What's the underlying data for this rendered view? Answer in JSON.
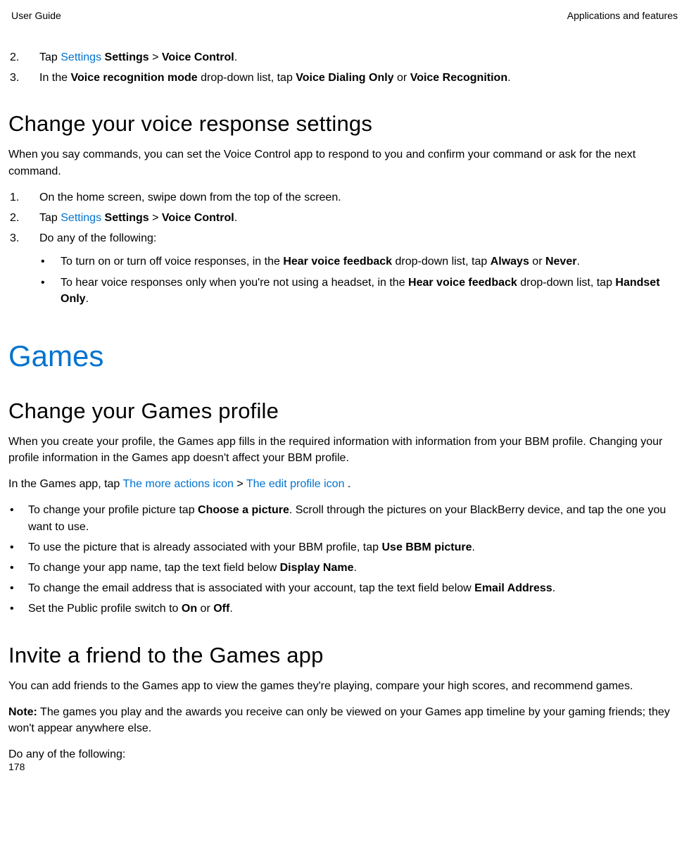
{
  "header": {
    "left": "User Guide",
    "right": "Applications and features"
  },
  "steps_top": {
    "item2": {
      "num": "2.",
      "pre": "Tap ",
      "blue": "Settings",
      "sp": " ",
      "b1": "Settings",
      "gt": " > ",
      "b2": "Voice Control",
      "end": "."
    },
    "item3": {
      "num": "3.",
      "pre": "In the ",
      "b1": "Voice recognition mode",
      "mid": " drop-down list, tap ",
      "b2": "Voice Dialing Only",
      "or": " or ",
      "b3": "Voice Recognition",
      "end": "."
    }
  },
  "h2a": "Change your voice response settings",
  "p1": "When you say commands, you can set the Voice Control app to respond to you and confirm your command or ask for the next command.",
  "steps_voice": {
    "item1": {
      "num": "1.",
      "text": "On the home screen, swipe down from the top of the screen."
    },
    "item2": {
      "num": "2.",
      "pre": "Tap ",
      "blue": "Settings",
      "sp": "  ",
      "b1": "Settings",
      "gt": " > ",
      "b2": "Voice Control",
      "end": "."
    },
    "item3": {
      "num": "3.",
      "text": "Do any of the following:"
    }
  },
  "voice_bullets": {
    "b1": {
      "pre": "To turn on or turn off voice responses, in the ",
      "b1": "Hear voice feedback",
      "mid": " drop-down list, tap ",
      "b2": "Always",
      "or": " or ",
      "b3": "Never",
      "end": "."
    },
    "b2": {
      "pre": "To hear voice responses only when you're not using a headset, in the ",
      "b1": "Hear voice feedback",
      "mid": " drop-down list, tap ",
      "b2": "Handset Only",
      "end": "."
    }
  },
  "h1a": "Games",
  "h2b": "Change your Games profile",
  "p2": "When you create your profile, the Games app fills in the required information with information from your BBM profile. Changing your profile information in the Games app doesn't affect your BBM profile.",
  "p3": {
    "pre": "In the Games app, tap ",
    "blue1": "The more actions icon",
    "gt": "  > ",
    "blue2": "The edit profile icon",
    "end": " ."
  },
  "profile_bullets": {
    "b1": {
      "pre": "To change your profile picture tap ",
      "b1": "Choose a picture",
      "rest": ". Scroll through the pictures on your BlackBerry device, and tap the one you want to use."
    },
    "b2": {
      "pre": "To use the picture that is already associated with your BBM profile, tap ",
      "b1": "Use BBM picture",
      "end": "."
    },
    "b3": {
      "pre": "To change your app name, tap the text field below ",
      "b1": "Display Name",
      "end": "."
    },
    "b4": {
      "pre": "To change the email address that is associated with your account, tap the text field below ",
      "b1": "Email Address",
      "end": "."
    },
    "b5": {
      "pre": "Set the Public profile switch to ",
      "b1": "On",
      "or": " or ",
      "b2": "Off",
      "end": "."
    }
  },
  "h2c": "Invite a friend to the Games app",
  "p4": "You can add friends to the Games app to view the games they're playing, compare your high scores, and recommend games.",
  "p5": {
    "b": "Note:",
    "rest": " The games you play and the awards you receive can only be viewed on your Games app timeline by your gaming friends; they won't appear anywhere else."
  },
  "p6": "Do any of the following:",
  "pageNum": "178",
  "bullet": "•"
}
